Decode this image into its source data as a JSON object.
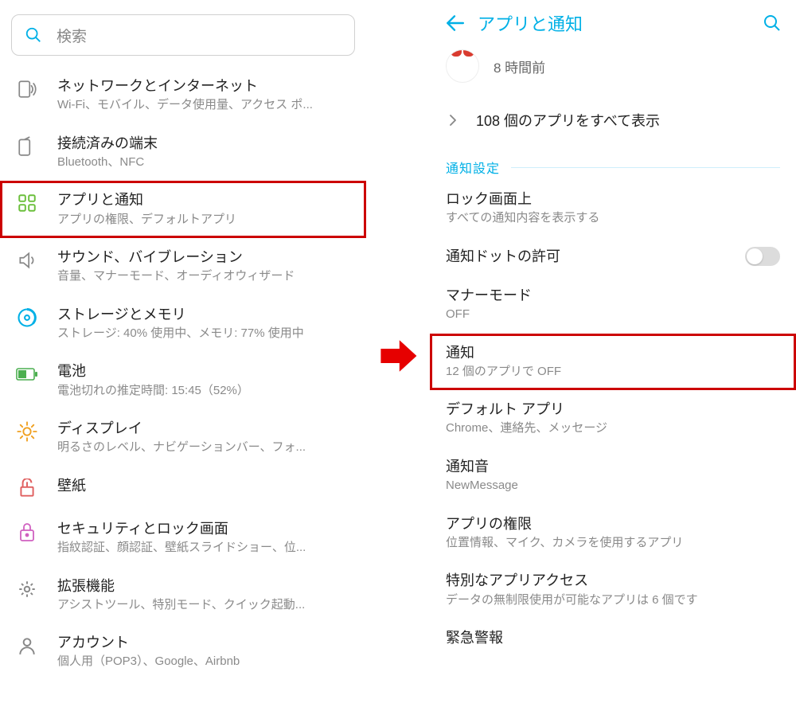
{
  "left": {
    "search_placeholder": "検索",
    "items": [
      {
        "title": "ネットワークとインターネット",
        "sub": "Wi-Fi、モバイル、データ使用量、アクセス ポ...",
        "icon": "network-icon",
        "highlight": false
      },
      {
        "title": "接続済みの端末",
        "sub": "Bluetooth、NFC",
        "icon": "connected-icon",
        "highlight": false
      },
      {
        "title": "アプリと通知",
        "sub": "アプリの権限、デフォルトアプリ",
        "icon": "apps-icon",
        "highlight": true
      },
      {
        "title": "サウンド、バイブレーション",
        "sub": "音量、マナーモード、オーディオウィザード",
        "icon": "sound-icon",
        "highlight": false
      },
      {
        "title": "ストレージとメモリ",
        "sub": "ストレージ: 40% 使用中、メモリ: 77% 使用中",
        "icon": "storage-icon",
        "highlight": false
      },
      {
        "title": "電池",
        "sub": "電池切れの推定時間: 15:45（52%）",
        "icon": "battery-icon",
        "highlight": false
      },
      {
        "title": "ディスプレイ",
        "sub": "明るさのレベル、ナビゲーションバー、フォ...",
        "icon": "display-icon",
        "highlight": false
      },
      {
        "title": "壁紙",
        "sub": "",
        "icon": "wallpaper-icon",
        "highlight": false
      },
      {
        "title": "セキュリティとロック画面",
        "sub": "指紋認証、顔認証、壁紙スライドショー、位...",
        "icon": "security-icon",
        "highlight": false
      },
      {
        "title": "拡張機能",
        "sub": "アシストツール、特別モード、クイック起動...",
        "icon": "extensions-icon",
        "highlight": false
      },
      {
        "title": "アカウント",
        "sub": "個人用（POP3）、Google、Airbnb",
        "icon": "account-icon",
        "highlight": false
      }
    ]
  },
  "right": {
    "header": "アプリと通知",
    "recent_time": "8 時間前",
    "all_apps": "108 個のアプリをすべて表示",
    "section_label": "通知設定",
    "items": [
      {
        "title": "ロック画面上",
        "sub": "すべての通知内容を表示する",
        "toggle": false,
        "highlight": false
      },
      {
        "title": "通知ドットの許可",
        "sub": "",
        "toggle": true,
        "highlight": false
      },
      {
        "title": "マナーモード",
        "sub": "OFF",
        "toggle": false,
        "highlight": false
      },
      {
        "title": "通知",
        "sub": "12 個のアプリで OFF",
        "toggle": false,
        "highlight": true
      },
      {
        "title": "デフォルト アプリ",
        "sub": "Chrome、連絡先、メッセージ",
        "toggle": false,
        "highlight": false
      },
      {
        "title": "通知音",
        "sub": "NewMessage",
        "toggle": false,
        "highlight": false
      },
      {
        "title": "アプリの権限",
        "sub": "位置情報、マイク、カメラを使用するアプリ",
        "toggle": false,
        "highlight": false
      },
      {
        "title": "特別なアプリアクセス",
        "sub": "データの無制限使用が可能なアプリは 6 個です",
        "toggle": false,
        "highlight": false
      },
      {
        "title": "緊急警報",
        "sub": "",
        "toggle": false,
        "highlight": false
      }
    ]
  }
}
